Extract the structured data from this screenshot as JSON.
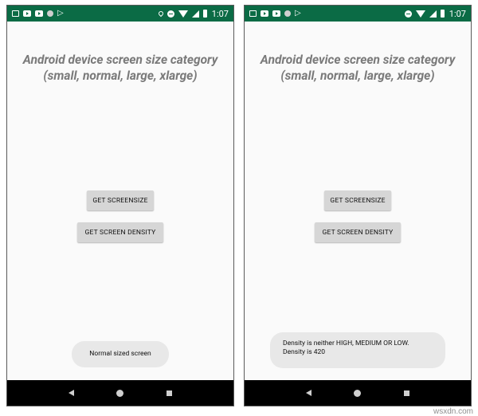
{
  "status_bar": {
    "time": "1:07"
  },
  "app": {
    "title_line1": "Android device screen size category",
    "title_line2": "(small, normal, large, xlarge)",
    "get_screensize_label": "GET SCREENSIZE",
    "get_screen_density_label": "GET SCREEN DENSITY"
  },
  "screens": [
    {
      "toast_lines": [
        "Normal sized screen"
      ]
    },
    {
      "toast_lines": [
        "Density is neither HIGH, MEDIUM OR LOW.",
        "Density is 420"
      ]
    }
  ],
  "watermark": "wsxdn.com",
  "colors": {
    "status_bar": "#0b6b45",
    "background": "#fafafa",
    "button": "#d6d6d6",
    "toast": "#e8e8e8",
    "title": "#7a7a7a"
  }
}
